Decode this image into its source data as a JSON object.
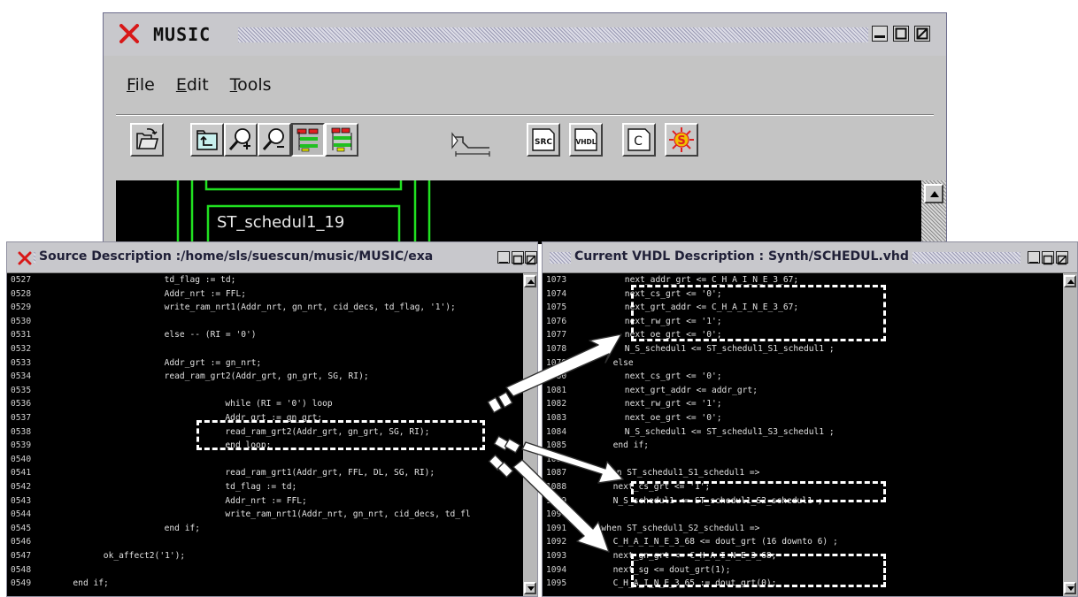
{
  "main_window": {
    "title": "MUSIC",
    "menu": [
      {
        "mnemonic": "F",
        "rest": "ile"
      },
      {
        "mnemonic": "E",
        "rest": "dit"
      },
      {
        "mnemonic": "T",
        "rest": "ools"
      }
    ],
    "toolbar": {
      "src_label": "SRC",
      "vhdl_label": "VHDL",
      "c_label": "C"
    },
    "canvas_node_label": "ST_schedul1_19"
  },
  "source_pane": {
    "title": "Source Description :/home/sls/suescun/music/MUSIC/exa",
    "lines": [
      {
        "n": "0527",
        "indent": 16,
        "text": "td_flag := td;"
      },
      {
        "n": "0528",
        "indent": 16,
        "text": "Addr_nrt := FFL;"
      },
      {
        "n": "0529",
        "indent": 16,
        "text": "write_ram_nrt1(Addr_nrt, gn_nrt, cid_decs, td_flag, '1');"
      },
      {
        "n": "0530",
        "indent": 16,
        "text": ""
      },
      {
        "n": "0531",
        "indent": 16,
        "text": "else -- (RI = '0')"
      },
      {
        "n": "0532",
        "indent": 16,
        "text": ""
      },
      {
        "n": "0533",
        "indent": 16,
        "text": "Addr_grt := gn_nrt;"
      },
      {
        "n": "0534",
        "indent": 16,
        "text": "read_ram_grt2(Addr_grt, gn_grt, SG, RI);"
      },
      {
        "n": "0535",
        "indent": 16,
        "text": ""
      },
      {
        "n": "0536",
        "indent": 24,
        "text": "while (RI = '0') loop"
      },
      {
        "n": "0537",
        "indent": 24,
        "text": "Addr_grt := gn_grt;"
      },
      {
        "n": "0538",
        "indent": 24,
        "text": "read_ram_grt2(Addr_grt, gn_grt, SG, RI);"
      },
      {
        "n": "0539",
        "indent": 24,
        "text": "end loop;"
      },
      {
        "n": "0540",
        "indent": 16,
        "text": ""
      },
      {
        "n": "0541",
        "indent": 24,
        "text": "read_ram_grt1(Addr_grt, FFL, DL, SG, RI);"
      },
      {
        "n": "0542",
        "indent": 24,
        "text": "td_flag := td;"
      },
      {
        "n": "0543",
        "indent": 24,
        "text": "Addr_nrt := FFL;"
      },
      {
        "n": "0544",
        "indent": 24,
        "text": "write_ram_nrt1(Addr_nrt, gn_nrt, cid_decs, td_fl"
      },
      {
        "n": "0545",
        "indent": 16,
        "text": "end if;"
      },
      {
        "n": "0546",
        "indent": 16,
        "text": ""
      },
      {
        "n": "0547",
        "indent": 8,
        "text": "ok_affect2('1');"
      },
      {
        "n": "0548",
        "indent": 8,
        "text": ""
      },
      {
        "n": "0549",
        "indent": 4,
        "text": "end if;"
      }
    ]
  },
  "vhdl_pane": {
    "title": "Current VHDL Description : Synth/SCHEDUL.vhd",
    "lines": [
      {
        "n": "1073",
        "indent": 8,
        "text": "next_addr_grt <= C_H_A_I_N_E_3_67;"
      },
      {
        "n": "1074",
        "indent": 8,
        "text": "next_cs_grt <= '0';"
      },
      {
        "n": "1075",
        "indent": 8,
        "text": "next_grt_addr <= C_H_A_I_N_E_3_67;"
      },
      {
        "n": "1076",
        "indent": 8,
        "text": "next_rw_grt <= '1';"
      },
      {
        "n": "1077",
        "indent": 8,
        "text": "next_oe_grt <= '0';"
      },
      {
        "n": "1078",
        "indent": 8,
        "text": "N_S_schedul1 <= ST_schedul1_S1_schedul1 ;"
      },
      {
        "n": "1079",
        "indent": 6,
        "text": "else"
      },
      {
        "n": "1080",
        "indent": 8,
        "text": "next_cs_grt <= '0';"
      },
      {
        "n": "1081",
        "indent": 8,
        "text": "next_grt_addr <= addr_grt;"
      },
      {
        "n": "1082",
        "indent": 8,
        "text": "next_rw_grt <= '1';"
      },
      {
        "n": "1083",
        "indent": 8,
        "text": "next_oe_grt <= '0';"
      },
      {
        "n": "1084",
        "indent": 8,
        "text": "N_S_schedul1 <= ST_schedul1_S3_schedul1 ;"
      },
      {
        "n": "1085",
        "indent": 6,
        "text": "end if;"
      },
      {
        "n": "1086",
        "indent": 4,
        "text": ""
      },
      {
        "n": "1087",
        "indent": 4,
        "text": "when ST_schedul1_S1_schedul1 =>"
      },
      {
        "n": "1088",
        "indent": 6,
        "text": "next_cs_grt <= '1';"
      },
      {
        "n": "1089",
        "indent": 6,
        "text": "N_S_schedul1 <= ST_schedul1_S2_schedul1 ;"
      },
      {
        "n": "1090",
        "indent": 4,
        "text": ""
      },
      {
        "n": "1091",
        "indent": 4,
        "text": "when ST_schedul1_S2_schedul1 =>"
      },
      {
        "n": "1092",
        "indent": 6,
        "text": "C_H_A_I_N_E_3_68 <= dout_grt (16 downto 6) ;"
      },
      {
        "n": "1093",
        "indent": 6,
        "text": "next_gn_grt <= C_H_A_I_N_E_3_68;"
      },
      {
        "n": "1094",
        "indent": 6,
        "text": "next_sg <= dout_grt(1);"
      },
      {
        "n": "1095",
        "indent": 6,
        "text": "C_H_A_I_N_E_3_65 := dout_grt(0);"
      }
    ]
  }
}
